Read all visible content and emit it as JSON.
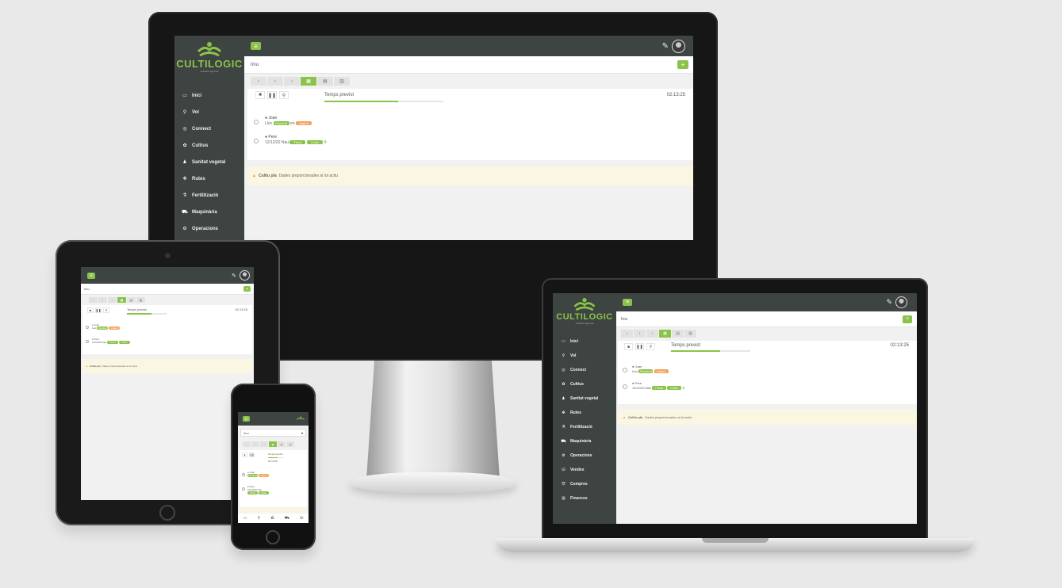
{
  "app": {
    "brand": "CULTILOGIC",
    "brand_tagline": "software agrícola",
    "menu_icon": "menu-icon",
    "search_placeholder": "Imu",
    "add_button": "+",
    "user_icon": "user-icon",
    "colors": {
      "accent": "#8bc34a",
      "dark": "#3d4442",
      "warn": "#f5a25d"
    }
  },
  "sidebar": {
    "items": [
      {
        "label": "Inici",
        "icon": "monitor-icon"
      },
      {
        "label": "Vol",
        "icon": "map-pin-icon"
      },
      {
        "label": "Connect",
        "icon": "eye-icon"
      },
      {
        "label": "Cultius",
        "icon": "plant-icon"
      },
      {
        "label": "Sanitat vegetal",
        "icon": "person-icon"
      },
      {
        "label": "Rutes",
        "icon": "paw-icon"
      },
      {
        "label": "Fertilització",
        "icon": "flask-icon"
      },
      {
        "label": "Maquinària",
        "icon": "tractor-icon"
      },
      {
        "label": "Operacions",
        "icon": "gear-icon"
      },
      {
        "label": "Vendes",
        "icon": "cart-icon"
      },
      {
        "label": "Compres",
        "icon": "tag-icon"
      },
      {
        "label": "Finances",
        "icon": "chart-icon"
      }
    ]
  },
  "toolbar": {
    "buttons": [
      "‹",
      "‹",
      "›",
      "▦",
      "▤",
      "▥"
    ],
    "active_index": 3
  },
  "timer": {
    "title": "Temps previst",
    "value": "02:13:25",
    "progress": 0.62
  },
  "tasks": [
    {
      "name": "Joan",
      "line": "Lloc",
      "tag1": "Pendent",
      "tag2": "Urgent"
    },
    {
      "name": "Pere",
      "date": "12/12/20",
      "line": "Nau",
      "tag1": "Finca",
      "tag2": "Cultiu"
    }
  ],
  "alert": {
    "label": "Cultiu pla",
    "text": "Dades proporcionades al lot actiu"
  },
  "phone": {
    "search_value": "Imu",
    "timer_title": "Temps previst"
  }
}
